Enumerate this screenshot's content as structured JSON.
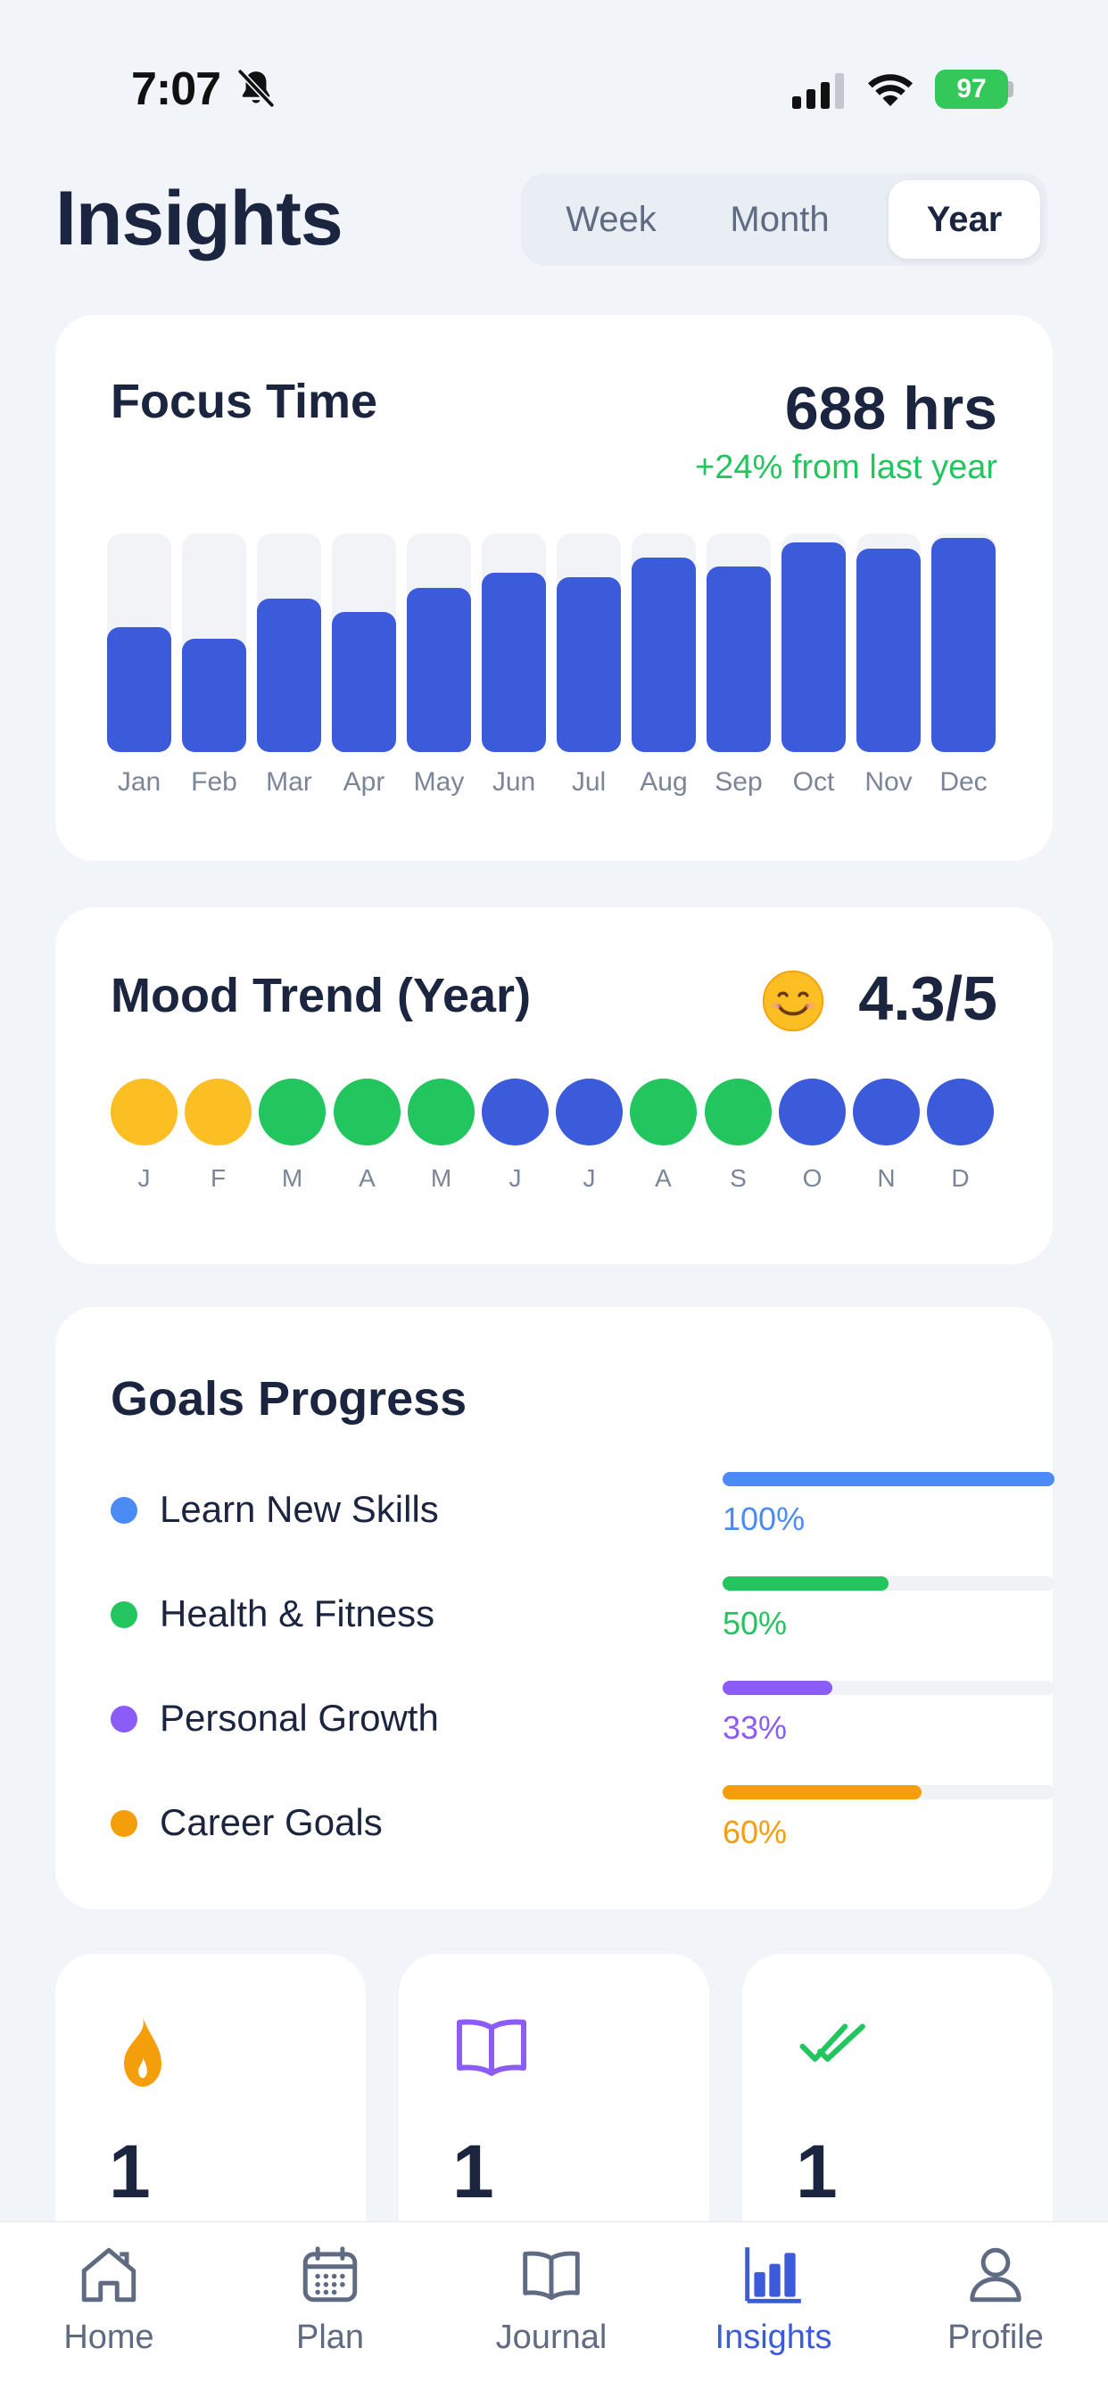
{
  "status_bar": {
    "time": "7:07",
    "battery": "97"
  },
  "header": {
    "title": "Insights",
    "segments": [
      "Week",
      "Month",
      "Year"
    ],
    "selected": "Year"
  },
  "focus_card": {
    "title": "Focus Time",
    "total": "688 hrs",
    "delta": "+24% from last year"
  },
  "chart_data": {
    "type": "bar",
    "categories": [
      "Jan",
      "Feb",
      "Mar",
      "Apr",
      "May",
      "Jun",
      "Jul",
      "Aug",
      "Sep",
      "Oct",
      "Nov",
      "Dec"
    ],
    "values": [
      0.57,
      0.52,
      0.7,
      0.64,
      0.75,
      0.82,
      0.8,
      0.89,
      0.85,
      0.96,
      0.93,
      0.98
    ],
    "ylim": [
      0,
      1
    ],
    "color": "#3b5bdb",
    "grid": false
  },
  "mood_card": {
    "title": "Mood Trend (Year)",
    "emoji": "smiling-face-icon",
    "score": "4.3/5",
    "months": [
      {
        "label": "J",
        "color": "#fbbf24"
      },
      {
        "label": "F",
        "color": "#fbbf24"
      },
      {
        "label": "M",
        "color": "#22c55e"
      },
      {
        "label": "A",
        "color": "#22c55e"
      },
      {
        "label": "M",
        "color": "#22c55e"
      },
      {
        "label": "J",
        "color": "#3b5bdb"
      },
      {
        "label": "J",
        "color": "#3b5bdb"
      },
      {
        "label": "A",
        "color": "#22c55e"
      },
      {
        "label": "S",
        "color": "#22c55e"
      },
      {
        "label": "O",
        "color": "#3b5bdb"
      },
      {
        "label": "N",
        "color": "#3b5bdb"
      },
      {
        "label": "D",
        "color": "#3b5bdb"
      }
    ]
  },
  "goals_card": {
    "title": "Goals Progress",
    "goals": [
      {
        "name": "Learn New Skills",
        "percent": "100%",
        "progress": 1.0,
        "color": "#4b8bf5"
      },
      {
        "name": "Health & Fitness",
        "percent": "50%",
        "progress": 0.5,
        "color": "#22c55e"
      },
      {
        "name": "Personal Growth",
        "percent": "33%",
        "progress": 0.33,
        "color": "#8b5cf6"
      },
      {
        "name": "Career Goals",
        "percent": "60%",
        "progress": 0.6,
        "color": "#f59e0b"
      }
    ]
  },
  "stats": [
    {
      "icon": "flame-icon",
      "value": "1",
      "color": "#f59e0b"
    },
    {
      "icon": "book-icon",
      "value": "1",
      "color": "#8b5cf6"
    },
    {
      "icon": "double-check-icon",
      "value": "1",
      "color": "#22c55e"
    }
  ],
  "tab_bar": {
    "tabs": [
      {
        "label": "Home",
        "icon": "home-icon"
      },
      {
        "label": "Plan",
        "icon": "calendar-icon"
      },
      {
        "label": "Journal",
        "icon": "book-icon"
      },
      {
        "label": "Insights",
        "icon": "bar-chart-icon"
      },
      {
        "label": "Profile",
        "icon": "person-icon"
      }
    ],
    "active": "Insights"
  }
}
